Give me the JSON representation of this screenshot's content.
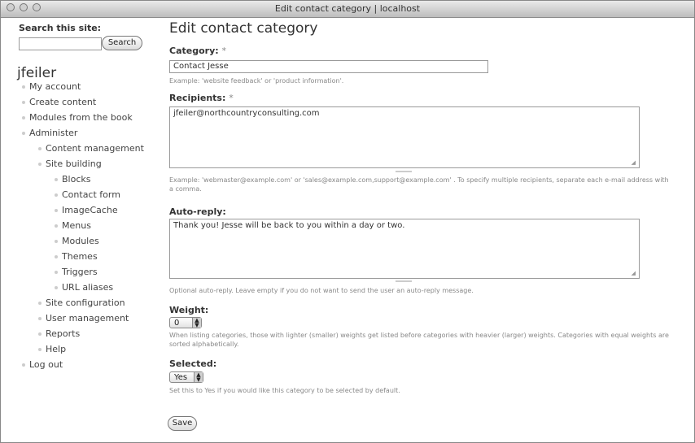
{
  "window": {
    "title": "Edit contact category | localhost"
  },
  "sidebar": {
    "search_label": "Search this site:",
    "search_placeholder": "",
    "search_button": "Search",
    "username": "jfeiler",
    "items": [
      {
        "label": "My account"
      },
      {
        "label": "Create content"
      },
      {
        "label": "Modules from the book"
      },
      {
        "label": "Administer"
      },
      {
        "label": "Content management"
      },
      {
        "label": "Site building"
      },
      {
        "label": "Blocks"
      },
      {
        "label": "Contact form"
      },
      {
        "label": "ImageCache"
      },
      {
        "label": "Menus"
      },
      {
        "label": "Modules"
      },
      {
        "label": "Themes"
      },
      {
        "label": "Triggers"
      },
      {
        "label": "URL aliases"
      },
      {
        "label": "Site configuration"
      },
      {
        "label": "User management"
      },
      {
        "label": "Reports"
      },
      {
        "label": "Help"
      },
      {
        "label": "Log out"
      }
    ]
  },
  "main": {
    "heading": "Edit contact category",
    "category": {
      "label": "Category:",
      "required": "*",
      "value": "Contact Jesse",
      "description": "Example: 'website feedback' or 'product information'."
    },
    "recipients": {
      "label": "Recipients:",
      "required": "*",
      "value": "jfeiler@northcountryconsulting.com",
      "description": "Example: 'webmaster@example.com' or 'sales@example.com,support@example.com' . To specify multiple recipients, separate each e-mail address with a comma."
    },
    "autoreply": {
      "label": "Auto-reply:",
      "value": "Thank you! Jesse will be back to you within a day or two.",
      "description": "Optional auto-reply. Leave empty if you do not want to send the user an auto-reply message."
    },
    "weight": {
      "label": "Weight:",
      "value": "0",
      "description": "When listing categories, those with lighter (smaller) weights get listed before categories with heavier (larger) weights. Categories with equal weights are sorted alphabetically."
    },
    "selected": {
      "label": "Selected:",
      "value": "Yes",
      "description": "Set this to Yes if you would like this category to be selected by default."
    },
    "save_button": "Save"
  }
}
